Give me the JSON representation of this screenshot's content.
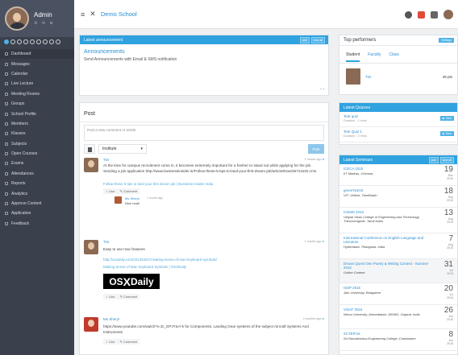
{
  "sidebar": {
    "user": {
      "name": "Admin",
      "icons": "⚙ ✉ ⊕"
    },
    "items": [
      {
        "label": "Dashboard"
      },
      {
        "label": "Messages"
      },
      {
        "label": "Calendar"
      },
      {
        "label": "Live Lecture"
      },
      {
        "label": "Meeting Rooms"
      },
      {
        "label": "Groups"
      },
      {
        "label": "School Profile"
      },
      {
        "label": "Members"
      },
      {
        "label": "Klasses"
      },
      {
        "label": "Subjects"
      },
      {
        "label": "Open Courses"
      },
      {
        "label": "Exams"
      },
      {
        "label": "Attendances"
      },
      {
        "label": "Reports"
      },
      {
        "label": "Analytics"
      },
      {
        "label": "Approve Content"
      },
      {
        "label": "Application"
      },
      {
        "label": "Feedback"
      }
    ]
  },
  "topbar": {
    "title": "Demo School"
  },
  "announcement": {
    "header": "Latest announcement",
    "add": "add",
    "view_all": "view all",
    "title": "Announcements",
    "body": "Send Announcements with Email & SMS notification",
    "pager": "‹ ›"
  },
  "post": {
    "title": "Post",
    "comment_placeholder": "Post a new comment or article",
    "audience": "Institute",
    "post_button": "Post"
  },
  "feed": [
    {
      "name": "Tim",
      "ago": "1 month ago",
      "text": "At the time for campus recruitment come in, it becomes extremely important for a fresher to stand out while applying for the job. Sending a job application http://www.businessinsider.in/Follow-these-5-tips-to-land-your-first-dream-job/articleshow/46713102.cms",
      "link": "Follow these 5 tips to land your first dream job | Business Insider India",
      "like": "Like",
      "comment": "Comment",
      "reply_name": "Ms Sheryl",
      "reply_ago": "1 month ago",
      "reply_text": "Nice read!"
    },
    {
      "name": "Tim",
      "ago": "1 month ago",
      "text": "Easy to use mac features",
      "url": "http://osxdaily.com/2013/03/27/making-sense-of-mac-keyboard-symbols/",
      "link": "Making Sense of Mac Keyboard Symbols | OSXDaily",
      "logo_a": "OS",
      "logo_b": "X",
      "logo_c": "Daily",
      "like": "Like",
      "comment": "Comment"
    },
    {
      "name": "Ms Sheryl",
      "ago": "4 months ago",
      "text": "https://www.youtube.com/watch?v=D_GPJYtuY-k for Components, Landing Gear systems of the subject Aircraft Systems And Instruments",
      "like": "Like",
      "comment": "Comment"
    }
  ],
  "top_performers": {
    "header": "Top performers",
    "settings": "Settings",
    "tabs": [
      "Student",
      "Faculty",
      "Class"
    ],
    "name": "Tim",
    "points": "49 pts"
  },
  "quizzes": {
    "header": "Latest Quizzes",
    "items": [
      {
        "title": "Test quiz",
        "duration": "Duration : 1 mins",
        "action": "Start"
      },
      {
        "title": "Test Quiz 1",
        "duration": "Duration : 2 mins",
        "action": "Start"
      }
    ]
  },
  "seminars": {
    "header": "Latest Seminars",
    "add": "add",
    "view_all": "view all",
    "items": [
      {
        "name": "ICECA 2015",
        "place": "IIT Madras, Chennai,",
        "day": "19",
        "month": "Dec",
        "year": "2015"
      },
      {
        "name": "greenTwe15",
        "place": "VIT, Vellore, TamilNadu",
        "day": "18",
        "month": "Sep",
        "year": "2015"
      },
      {
        "name": "ICEMS 2015",
        "place": "Vidyaa Vikas College of Engineering and Technology, Thiruchengode, Tamil Nadu",
        "day": "13",
        "month": "Aug",
        "year": "2015"
      },
      {
        "name": "International Conference on English Language and Literature",
        "place": "Hyderabad, Telangana, India",
        "day": "7",
        "month": "Aug",
        "year": "2015"
      },
      {
        "name": "Dream Quest One Poetry & Writing Contest - Summer 2015",
        "place": "Online Contest",
        "day": "31",
        "month": "Jul",
        "year": "2015"
      },
      {
        "name": "ISSP 2015",
        "place": "Jain University, Bangalore",
        "day": "20",
        "month": "Jul",
        "year": "2015"
      },
      {
        "name": "VSIAT 2015",
        "place": "Nirma University, Ahmedabad- 382481, Gujarat, India",
        "day": "26",
        "month": "Jun",
        "year": "2015"
      },
      {
        "name": "SCTER'15",
        "place": "Sri Ramakrishna Engineering College, Coimbatore",
        "day": "8",
        "month": "Jun",
        "year": "2015"
      }
    ]
  }
}
